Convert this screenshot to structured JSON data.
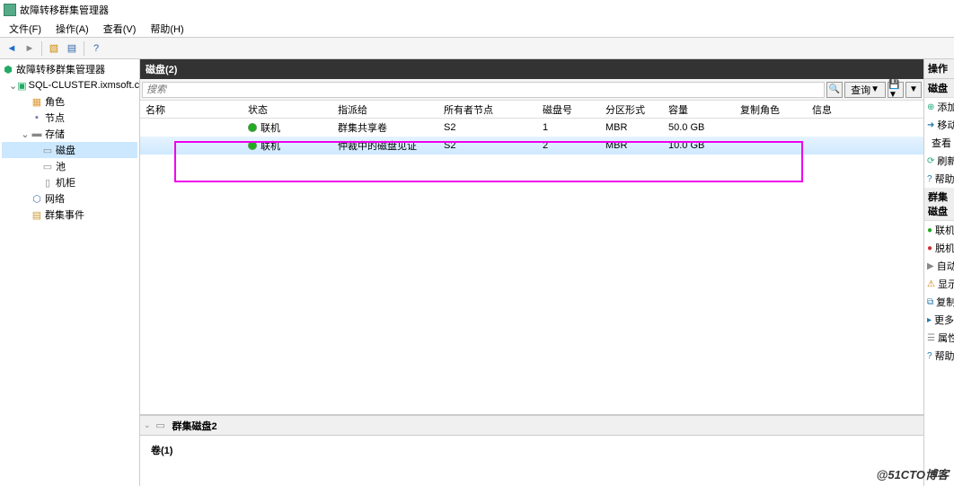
{
  "window": {
    "title": "故障转移群集管理器"
  },
  "menu": {
    "file": "文件(F)",
    "action": "操作(A)",
    "view": "查看(V)",
    "help": "帮助(H)"
  },
  "tree": {
    "root": "故障转移群集管理器",
    "cluster": "SQL-CLUSTER.ixmsoft.com",
    "roles": "角色",
    "nodes": "节点",
    "storage": "存储",
    "disks": "磁盘",
    "pools": "池",
    "cabinets": "机柜",
    "networks": "网络",
    "events": "群集事件"
  },
  "center": {
    "header": "磁盘(2)",
    "search_placeholder": "搜索",
    "query_btn": "查询"
  },
  "columns": {
    "name": "名称",
    "status": "状态",
    "assigned": "指派给",
    "owner": "所有者节点",
    "disknum": "磁盘号",
    "partition": "分区形式",
    "capacity": "容量",
    "role": "复制角色",
    "info": "信息"
  },
  "rows": [
    {
      "status": "联机",
      "assigned": "群集共享卷",
      "owner": "S2",
      "disknum": "1",
      "partition": "MBR",
      "capacity": "50.0 GB"
    },
    {
      "status": "联机",
      "assigned": "仲裁中的磁盘见证",
      "owner": "S2",
      "disknum": "2",
      "partition": "MBR",
      "capacity": "10.0 GB"
    }
  ],
  "detail": {
    "title": "群集磁盘2",
    "volumes": "卷(1)"
  },
  "actions": {
    "header": "操作",
    "sub1": "磁盘",
    "items1": [
      "添加磁盘",
      "移动可用存储",
      "查看",
      "刷新",
      "帮助"
    ],
    "sub2": "群集磁盘",
    "items2": [
      "联机",
      "脱机",
      "自动启动",
      "显示严重事件",
      "复制",
      "更多操作",
      "属性",
      "帮助"
    ]
  },
  "watermark": "@51CTO博客"
}
